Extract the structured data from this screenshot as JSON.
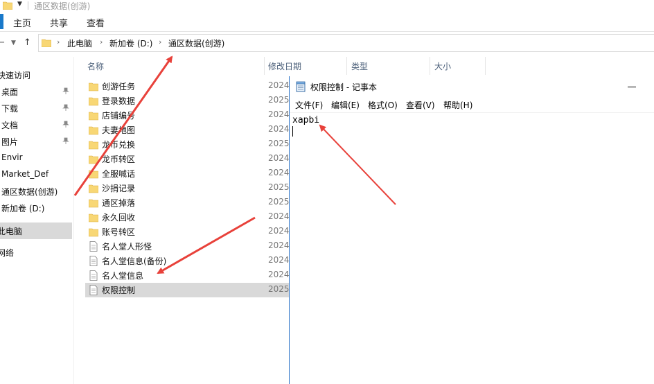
{
  "window": {
    "title": "通区数据(创游)",
    "quick_access_icon": "folder-icon",
    "quick_access_dropdown_icon": "chevron-down-icon"
  },
  "ribbon": {
    "tabs": [
      "主页",
      "共享",
      "查看"
    ]
  },
  "address": {
    "back_icon": "back-arrow-icon",
    "up_icon": "up-arrow-icon",
    "crumbs": [
      "此电脑",
      "新加卷 (D:)",
      "通区数据(创游)"
    ]
  },
  "nav_pane": {
    "items": [
      {
        "label": "快速访问",
        "pinned": false
      },
      {
        "label": "桌面",
        "pinned": true
      },
      {
        "label": "下载",
        "pinned": true
      },
      {
        "label": "文档",
        "pinned": true
      },
      {
        "label": "图片",
        "pinned": true
      },
      {
        "label": "Envir",
        "pinned": false
      },
      {
        "label": "Market_Def",
        "pinned": false
      },
      {
        "label": "通区数据(创游)",
        "pinned": false
      },
      {
        "label": "新加卷 (D:)",
        "pinned": false
      },
      {
        "label": "此电脑",
        "pinned": false,
        "selected": true
      },
      {
        "label": "网络",
        "pinned": false
      }
    ]
  },
  "file_list": {
    "columns": [
      "名称",
      "修改日期",
      "类型",
      "大小"
    ],
    "rows": [
      {
        "name": "创游任务",
        "type": "folder",
        "date": "2024"
      },
      {
        "name": "登录数据",
        "type": "folder",
        "date": "2025"
      },
      {
        "name": "店铺编号",
        "type": "folder",
        "date": "2024"
      },
      {
        "name": "夫妻地图",
        "type": "folder",
        "date": "2024"
      },
      {
        "name": "龙币兑换",
        "type": "folder",
        "date": "2025"
      },
      {
        "name": "龙币转区",
        "type": "folder",
        "date": "2024"
      },
      {
        "name": "全服喊话",
        "type": "folder",
        "date": "2024"
      },
      {
        "name": "沙捐记录",
        "type": "folder",
        "date": "2025"
      },
      {
        "name": "通区掉落",
        "type": "folder",
        "date": "2025"
      },
      {
        "name": "永久回收",
        "type": "folder",
        "date": "2024"
      },
      {
        "name": "账号转区",
        "type": "folder",
        "date": "2024"
      },
      {
        "name": "名人堂人形怪",
        "type": "file",
        "date": "2024"
      },
      {
        "name": "名人堂信息(备份)",
        "type": "file",
        "date": "2024"
      },
      {
        "name": "名人堂信息",
        "type": "file",
        "date": "2024"
      },
      {
        "name": "权限控制",
        "type": "file",
        "date": "2025",
        "selected": true
      }
    ]
  },
  "notepad": {
    "title": "权限控制 - 记事本",
    "menu": [
      "文件(F)",
      "编辑(E)",
      "格式(O)",
      "查看(V)",
      "帮助(H)"
    ],
    "content": "xapbi"
  },
  "colors": {
    "accent": "#1979ca",
    "selection": "#d9d9d9",
    "annotation": "#e8413a",
    "folder": "#f8d775"
  }
}
